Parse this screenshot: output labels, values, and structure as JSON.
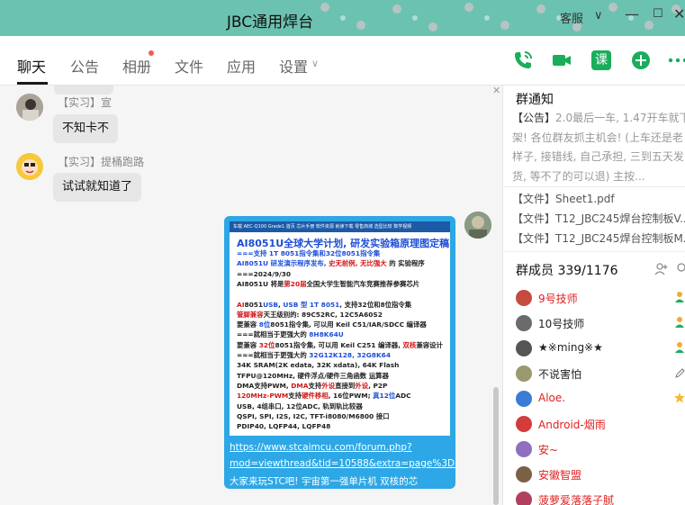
{
  "window": {
    "title": "JBC通用焊台",
    "ctl_label": "客服"
  },
  "tabs": [
    {
      "label": "聊天"
    },
    {
      "label": "公告"
    },
    {
      "label": "相册"
    },
    {
      "label": "文件"
    },
    {
      "label": "应用"
    },
    {
      "label": "设置"
    }
  ],
  "toolbar": {
    "course_label": "课"
  },
  "messages": [
    {
      "nick": "【实习】宣",
      "text": "不知卡不"
    },
    {
      "nick": "【实习】提桶跑路",
      "text": "试试就知道了"
    }
  ],
  "image_message": {
    "bar_text": "车载 AEC-Q100 Grade1   首页   芯片手册   软件资源   就读下载   零售商城   选型比较   数学视频",
    "heading": "AI8051U全球大学计划, 研发实验箱原理图定稿",
    "lines": [
      {
        "p": [
          [
            "b",
            "===支持 1T 8051指令集和32位8051指令集"
          ]
        ]
      },
      {
        "p": [
          [
            "b",
            "AI8051U 研发演示程序发布, "
          ],
          [
            "r",
            "史无前例, 无比强大"
          ],
          [
            "k",
            " 的 实验程序"
          ]
        ]
      },
      {
        "p": [
          [
            "k",
            "===2024/9/30"
          ]
        ]
      },
      {
        "p": [
          [
            "k",
            "AI8051U 将是"
          ],
          [
            "r",
            "第20届"
          ],
          [
            "k",
            "全国大学生智能汽车竞赛推荐参赛芯片"
          ]
        ]
      },
      {
        "p": [
          [
            "k",
            ""
          ]
        ]
      },
      {
        "p": [
          [
            "r",
            "AI"
          ],
          [
            "k",
            "8051"
          ],
          [
            "b",
            "USB"
          ],
          [
            "k",
            ", "
          ],
          [
            "b",
            "USB 型 1T 8051"
          ],
          [
            "k",
            ", 支持32位和8位指令集"
          ]
        ]
      },
      {
        "p": [
          [
            "r",
            "管脚兼容"
          ],
          [
            "k",
            "天王级别的: 89C52RC, 12C5A60S2"
          ]
        ]
      },
      {
        "p": [
          [
            "k",
            "要兼容 "
          ],
          [
            "b",
            "8位"
          ],
          [
            "k",
            "8051指令集, 可以用 Keil C51/IAR/SDCC 编译器"
          ]
        ]
      },
      {
        "p": [
          [
            "k",
            "===就相当于更强大的 "
          ],
          [
            "b",
            "8H8K64U"
          ]
        ]
      },
      {
        "p": [
          [
            "k",
            "要兼容 "
          ],
          [
            "r",
            "32位"
          ],
          [
            "k",
            "8051指令集, 可以用 Keil C251 编译器, "
          ],
          [
            "r",
            "双核"
          ],
          [
            "k",
            "兼容设计"
          ]
        ]
      },
      {
        "p": [
          [
            "k",
            "===就相当于更强大的 "
          ],
          [
            "b",
            "32G12K128, 32G8K64"
          ]
        ]
      },
      {
        "p": [
          [
            "k",
            "34K SRAM(2K edata, 32K xdata), 64K Flash"
          ]
        ]
      },
      {
        "p": [
          [
            "k",
            "TFPU@120MHz, 硬件浮点/硬件三角函数 运算器"
          ]
        ]
      },
      {
        "p": [
          [
            "k",
            "DMA支持PWM, "
          ],
          [
            "r",
            "DMA"
          ],
          [
            "k",
            "支持"
          ],
          [
            "r",
            "外设"
          ],
          [
            "k",
            "直接到"
          ],
          [
            "r",
            "外设"
          ],
          [
            "k",
            ", P2P"
          ]
        ]
      },
      {
        "p": [
          [
            "r",
            "120MHz-PWM"
          ],
          [
            "k",
            "支持"
          ],
          [
            "r",
            "硬件移相"
          ],
          [
            "k",
            ", 16位PWM; "
          ],
          [
            "b",
            "真12位"
          ],
          [
            "k",
            "ADC"
          ]
        ]
      },
      {
        "p": [
          [
            "k",
            "USB, 4组串口, 12位ADC, 轨到轨比较器"
          ]
        ]
      },
      {
        "p": [
          [
            "k",
            "QSPI, SPI, I2S, I2C, TFT-i8080/M6800 接口"
          ]
        ]
      },
      {
        "p": [
          [
            "k",
            "PDIP40, LQFP44, LQFP48"
          ]
        ]
      }
    ],
    "link_line1": "https://www.stcaimcu.com/forum.php?",
    "link_line2": "mod=viewthread&tid=10588&extra=page%3D1",
    "caption": "大家来玩STC吧! 宇宙第一强单片机 双核的芯"
  },
  "panel": {
    "notice_title": "群通知",
    "notice_tag": "【公告】",
    "notice_text": "2.0最后一车, 1.47开车就下架! 各位群友抓主机会! (上车还是老样子, 接错线, 自己承担, 三到五天发货, 等不了的可以退) 主按...",
    "files": [
      "【文件】Sheet1.pdf",
      "【文件】T12_JBC245焊台控制板V...",
      "【文件】T12_JBC245焊台控制板M..."
    ],
    "members_title": "群成员 339/1176",
    "members": [
      {
        "name": "9号技师",
        "color": "#e02020"
      },
      {
        "name": "10号技师",
        "color": "#222222"
      },
      {
        "name": "★※ming※★",
        "color": "#222222"
      },
      {
        "name": "不说害怕",
        "color": "#222222"
      },
      {
        "name": "Aloe.",
        "color": "#e02020"
      },
      {
        "name": "Android-烟雨",
        "color": "#e02020"
      },
      {
        "name": "安~",
        "color": "#e02020"
      },
      {
        "name": "安徽智盟",
        "color": "#e02020"
      },
      {
        "name": "菠萝爱落落子腻",
        "color": "#e02020"
      }
    ]
  },
  "colors": {
    "accent_green": "#1aad5b",
    "mention_red": "#e02020",
    "image_card_blue": "#2da7e6"
  }
}
